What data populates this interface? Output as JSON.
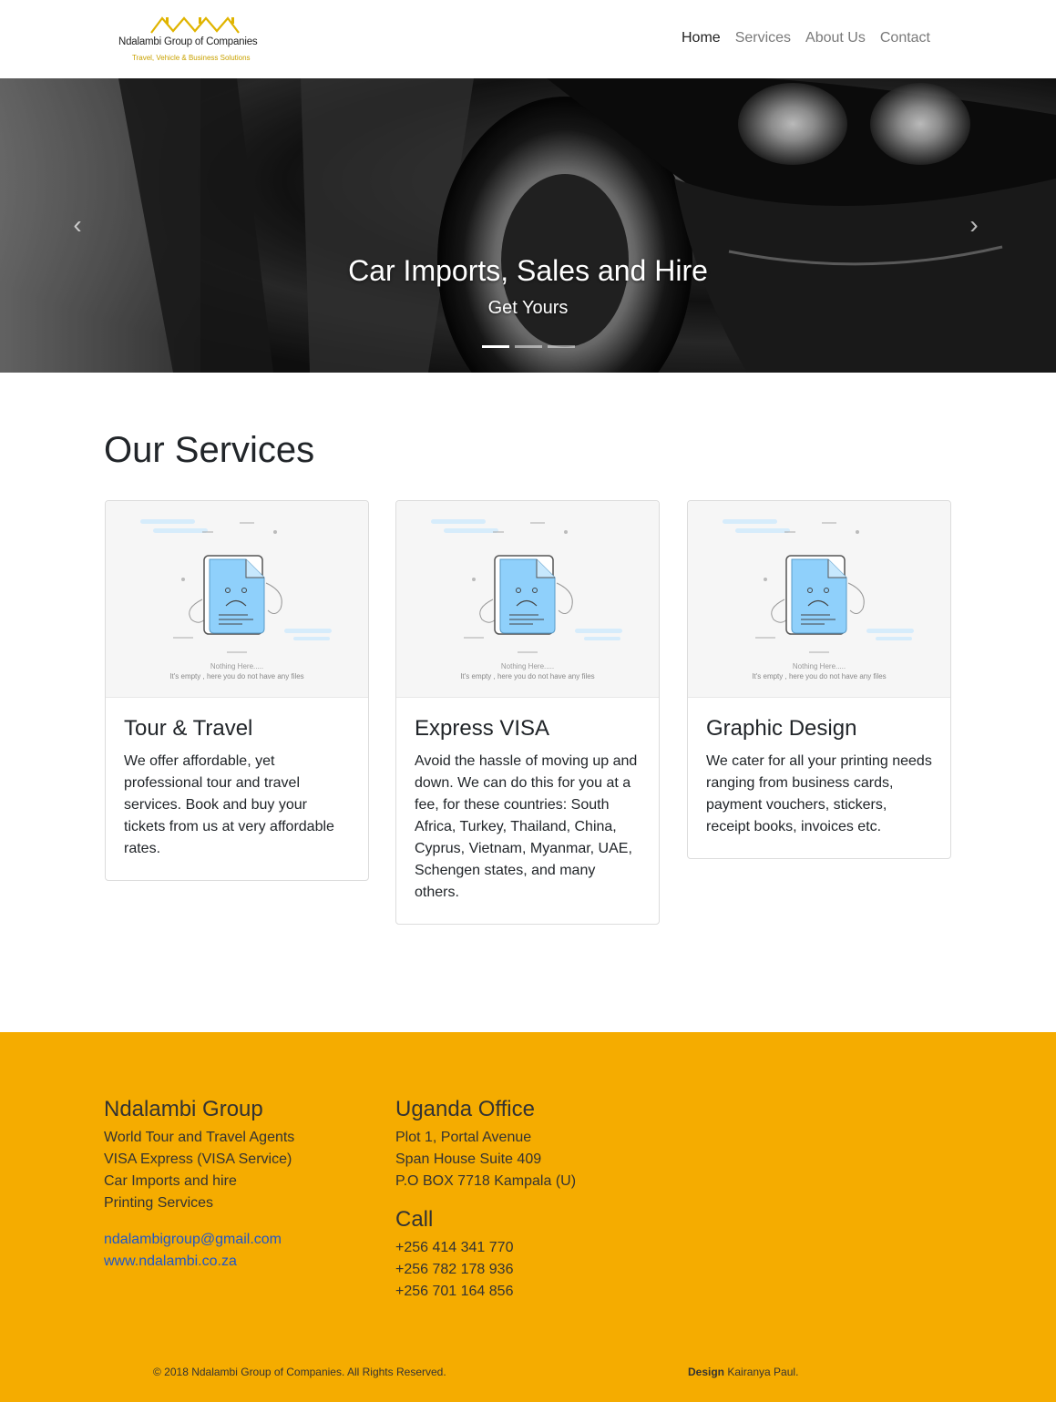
{
  "brand": {
    "name": "Ndalambi Group of Companies",
    "tagline": "Travel, Vehicle & Business Solutions",
    "accent": "#f5ac00",
    "logo_gold": "#e0b400"
  },
  "nav": {
    "items": [
      {
        "label": "Home",
        "active": true
      },
      {
        "label": "Services",
        "active": false
      },
      {
        "label": "About Us",
        "active": false
      },
      {
        "label": "Contact",
        "active": false
      }
    ]
  },
  "carousel": {
    "title": "Car Imports, Sales and Hire",
    "subtitle": "Get Yours",
    "prev_icon": "chevron-left-icon",
    "next_icon": "chevron-right-icon",
    "slides": 3,
    "active_slide": 1
  },
  "services": {
    "heading": "Our Services",
    "image_text_1": "Nothing Here.....",
    "image_text_2": "It's empty , here you do not have any files",
    "cards": [
      {
        "title": "Tour & Travel",
        "text": "We offer affordable, yet professional tour and travel services. Book and buy your tickets from us at very affordable rates."
      },
      {
        "title": "Express VISA",
        "text": "Avoid the hassle of moving up and down. We can do this for you at a fee, for these countries: South Africa, Turkey, Thailand, China, Cyprus, Vietnam, Myanmar, UAE, Schengen states, and many others."
      },
      {
        "title": "Graphic Design",
        "text": "We cater for all your printing needs ranging from business cards, payment vouchers, stickers, receipt books, invoices etc."
      }
    ]
  },
  "footer": {
    "col1": {
      "heading": "Ndalambi Group",
      "lines": [
        "World Tour and Travel Agents",
        "VISA Express (VISA Service)",
        "Car Imports and hire",
        "Printing Services"
      ],
      "email": "ndalambigroup@gmail.com",
      "website": "www.ndalambi.co.za"
    },
    "col2": {
      "heading": "Uganda Office",
      "lines": [
        "Plot 1, Portal Avenue",
        "Span House Suite 409",
        "P.O BOX 7718 Kampala (U)"
      ],
      "call_heading": "Call",
      "phones": [
        "+256 414 341 770",
        "+256 782 178 936",
        "+256 701 164 856"
      ]
    },
    "copyright": "© 2018 Ndalambi Group of Companies. All Rights Reserved.",
    "design_label": "Design",
    "design_name": "Kairanya Paul."
  }
}
